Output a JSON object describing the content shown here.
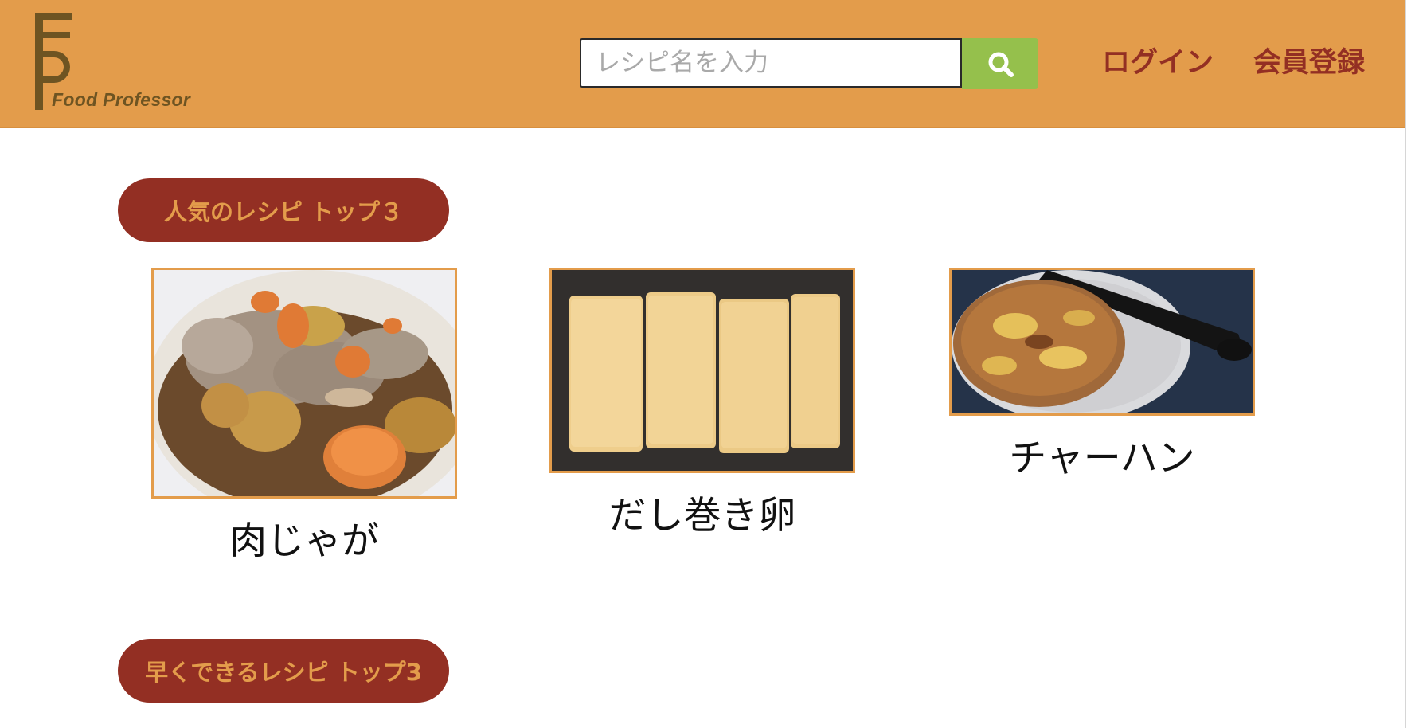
{
  "header": {
    "logo_text": "Food Professor",
    "search": {
      "placeholder": "レシピ名を入力",
      "value": ""
    },
    "nav": {
      "login": "ログイン",
      "register": "会員登録"
    }
  },
  "sections": {
    "popular": {
      "title": "人気のレシピ トップ３",
      "recipes": [
        {
          "name": "肉じゃが"
        },
        {
          "name": "だし巻き卵"
        },
        {
          "name": "チャーハン"
        }
      ]
    },
    "quick": {
      "title": "早くできるレシピ トップ3"
    }
  },
  "colors": {
    "header_bg": "#e39c4b",
    "accent_red": "#932f23",
    "search_button": "#95c04c",
    "logo_brown": "#6e5422"
  }
}
